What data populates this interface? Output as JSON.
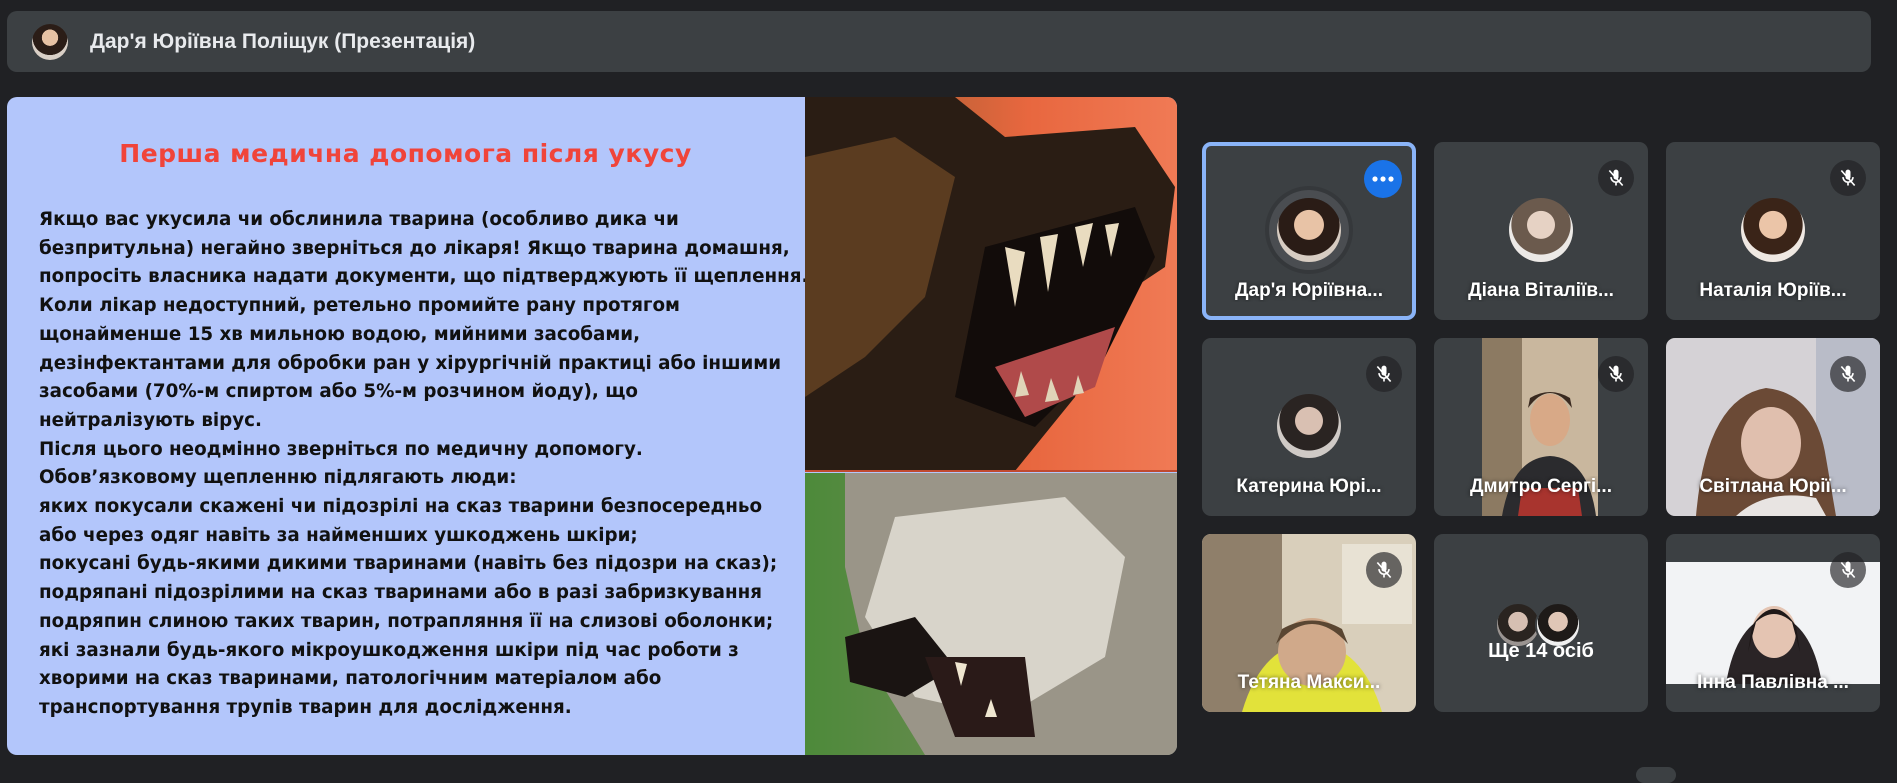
{
  "header": {
    "presenter_title": "Дар'я Юріївна Поліщук (Презентація)"
  },
  "slide": {
    "title": "Перша медична допомога після укусу",
    "lines": [
      "Якщо вас укусила чи обслинила тварина (особливо дика чи",
      "безпритульна) негайно зверніться до лікаря! Якщо тварина домашня,",
      "попросіть власника надати документи, що підтверджують її щеплення.",
      "Коли лікар недоступний, ретельно промийте рану протягом",
      "щонайменше 15 хв мильною водою, мийними засобами,",
      "дезінфектантами для обробки ран у хірургічній практиці або іншими",
      "засобами (70%-м спиртом або 5%-м розчином йоду), що",
      "нейтралізують вірус.",
      "Після цього неодмінно зверніться по медичну допомогу.",
      "Обов’язковому щепленню підлягають люди:",
      "яких покусали скажені чи підозрілі на сказ тварини безпосередньо",
      "або через одяг навіть за найменших ушкоджень шкіри;",
      "покусані будь-якими дикими тваринами (навіть без підозри на сказ);",
      "подряпані підозрілими на сказ тваринами або в разі забризкування",
      "подряпин слиною таких тварин, потрапляння її на слизові оболонки;",
      "які зазнали будь-якого мікроушкодження шкіри під час роботи з",
      "хворими на сказ тваринами, патологічним матеріалом або",
      "транспортування трупів тварин для дослідження."
    ]
  },
  "participants": [
    {
      "name": "Дар'я Юріївна...",
      "active": true
    },
    {
      "name": "Діана Віталіїв..."
    },
    {
      "name": "Наталія Юріїв..."
    },
    {
      "name": "Катерина Юрі..."
    },
    {
      "name": "Дмитро Сергі..."
    },
    {
      "name": "Світлана Юрії..."
    },
    {
      "name": "Тетяна Макси..."
    },
    {
      "more_label": "Ще 14 осіб"
    },
    {
      "name": "Інна Павлівна ..."
    }
  ],
  "colors": {
    "accent": "#1a73e8",
    "active_border": "#8ab4f8",
    "slide_title": "#f0443a",
    "slide_bg": "#b3c6fb"
  }
}
